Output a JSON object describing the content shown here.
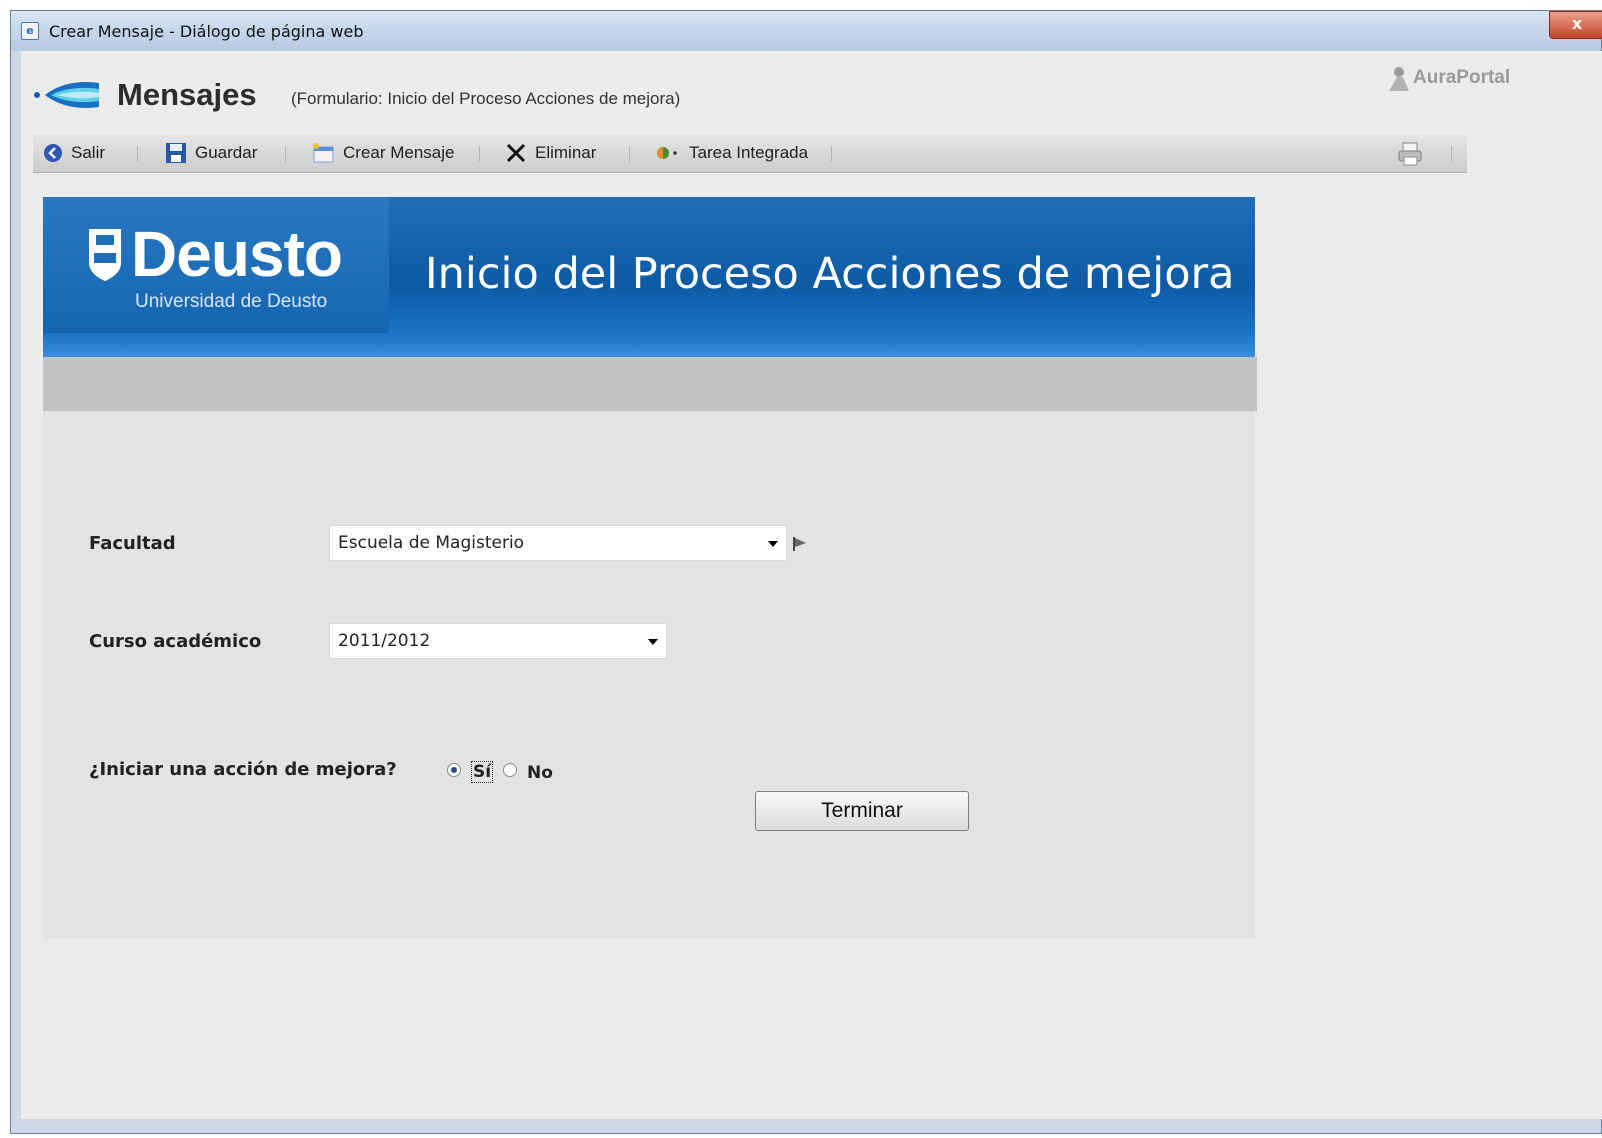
{
  "window": {
    "title": "Crear Mensaje - Diálogo de página web",
    "close_label": "x"
  },
  "header": {
    "title": "Mensajes",
    "subtitle": "(Formulario: Inicio del Proceso Acciones de mejora)",
    "brand": "AuraPortal"
  },
  "toolbar": {
    "exit_label": "Salir",
    "save_label": "Guardar",
    "create_label": "Crear Mensaje",
    "delete_label": "Eliminar",
    "task_label": "Tarea Integrada"
  },
  "banner": {
    "logo_name": "Deusto",
    "logo_subtitle": "Universidad de Deusto",
    "title": "Inicio del Proceso Acciones de mejora"
  },
  "form": {
    "faculty_label": "Facultad",
    "faculty_value": "Escuela de Magisterio",
    "year_label": "Curso académico",
    "year_value": "2011/2012",
    "question_label": "¿Iniciar una acción de mejora?",
    "option_yes": "Sí",
    "option_no": "No",
    "selected_option": "Sí",
    "submit_label": "Terminar"
  },
  "colors": {
    "banner_blue": "#0e5aa4",
    "panel_grey": "#e3e3e3",
    "strip_grey": "#c2c2c2"
  }
}
